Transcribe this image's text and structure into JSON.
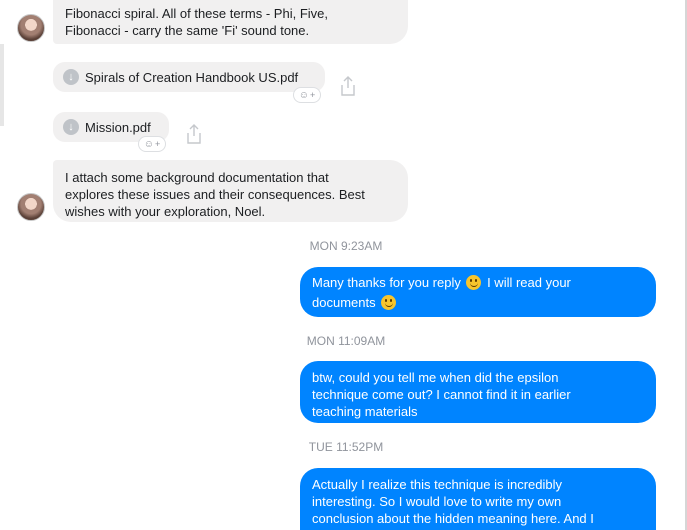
{
  "messages": {
    "in1": {
      "line1": "Fibonacci spiral.  All of these terms - Phi, Five,",
      "line2": "Fibonacci - carry the same 'Fi' sound tone."
    },
    "file1": {
      "name": "Spirals of Creation Handbook US.pdf"
    },
    "file2": {
      "name": "Mission.pdf"
    },
    "in2": {
      "line1": "I attach some background documentation that",
      "line2": "explores these issues and their consequences.  Best",
      "line3": "wishes with your exploration, Noel."
    },
    "ts1": "MON 9:23AM",
    "out1": {
      "line1a": "Many thanks for you reply ",
      "line1b": " I will read your",
      "line2": "documents "
    },
    "ts2": "MON 11:09AM",
    "out2": {
      "line1": "btw, could you tell me when did the epsilon",
      "line2": "technique come out? I cannot find it in earlier",
      "line3": "teaching materials"
    },
    "ts3": "TUE 11:52PM",
    "out3": {
      "line1": "Actually I realize this technique is incredibly",
      "line2": "interesting. So I would love to write my own",
      "line3": "conclusion about the hidden meaning here. And I"
    }
  },
  "icons": {
    "download": "download-arrow-icon",
    "share": "share-icon",
    "reaction": "add-reaction-icon",
    "emoji": "smiley-emoji-icon"
  },
  "colors": {
    "outgoing": "#0084ff",
    "incoming": "#f1f0f0",
    "timestamp": "#90949c"
  }
}
